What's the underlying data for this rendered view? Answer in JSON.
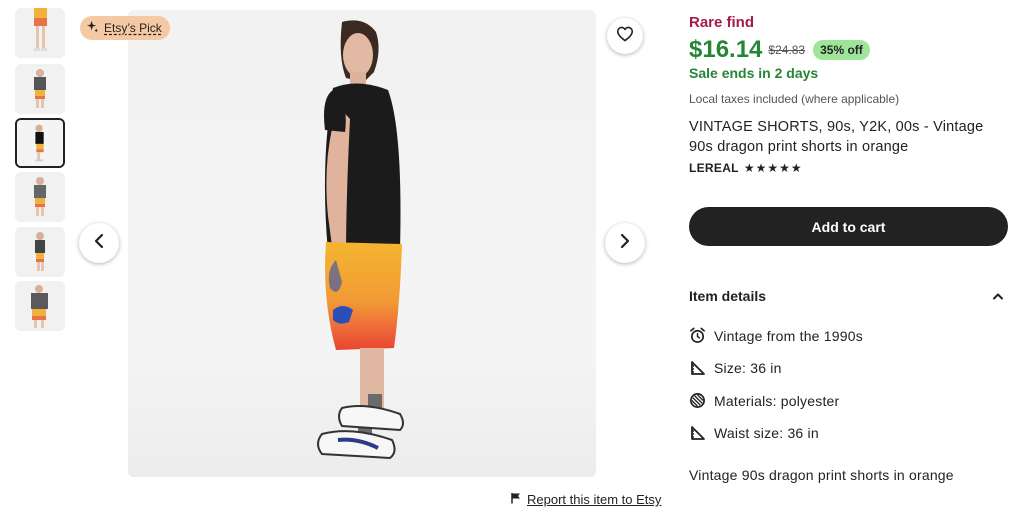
{
  "badge": {
    "label": "Etsy’s Pick",
    "icon": "sparkle-icon"
  },
  "product": {
    "rare_label": "Rare find",
    "price": "$16.14",
    "original_price": "$24.83",
    "discount": "35% off",
    "sale_text": "Sale ends in 2 days",
    "taxes_note": "Local taxes included (where applicable)",
    "title": "VINTAGE SHORTS, 90s, Y2K, 00s - Vintage 90s dragon print shorts in orange",
    "shop_name": "LEREAL",
    "rating_stars": "★★★★★",
    "rating": 5,
    "add_to_cart": "Add to cart"
  },
  "details": {
    "heading": "Item details",
    "items": [
      {
        "icon": "alarm-clock-icon",
        "text": "Vintage from the 1990s"
      },
      {
        "icon": "ruler-triangle-icon",
        "text": "Size: 36 in"
      },
      {
        "icon": "fabric-swatch-icon",
        "text": "Materials: polyester"
      },
      {
        "icon": "ruler-triangle-icon",
        "text": "Waist size: 36 in"
      }
    ],
    "description": "Vintage 90s dragon print shorts in orange"
  },
  "report_link": "Report this item to Etsy",
  "thumbnails": {
    "count": 6,
    "selected_index": 2
  },
  "colors": {
    "price_green": "#258635",
    "rare_red": "#a61a4a",
    "discount_bg": "#9ee59a",
    "badge_bg": "#f5c9a4",
    "button_dark": "#222222"
  }
}
